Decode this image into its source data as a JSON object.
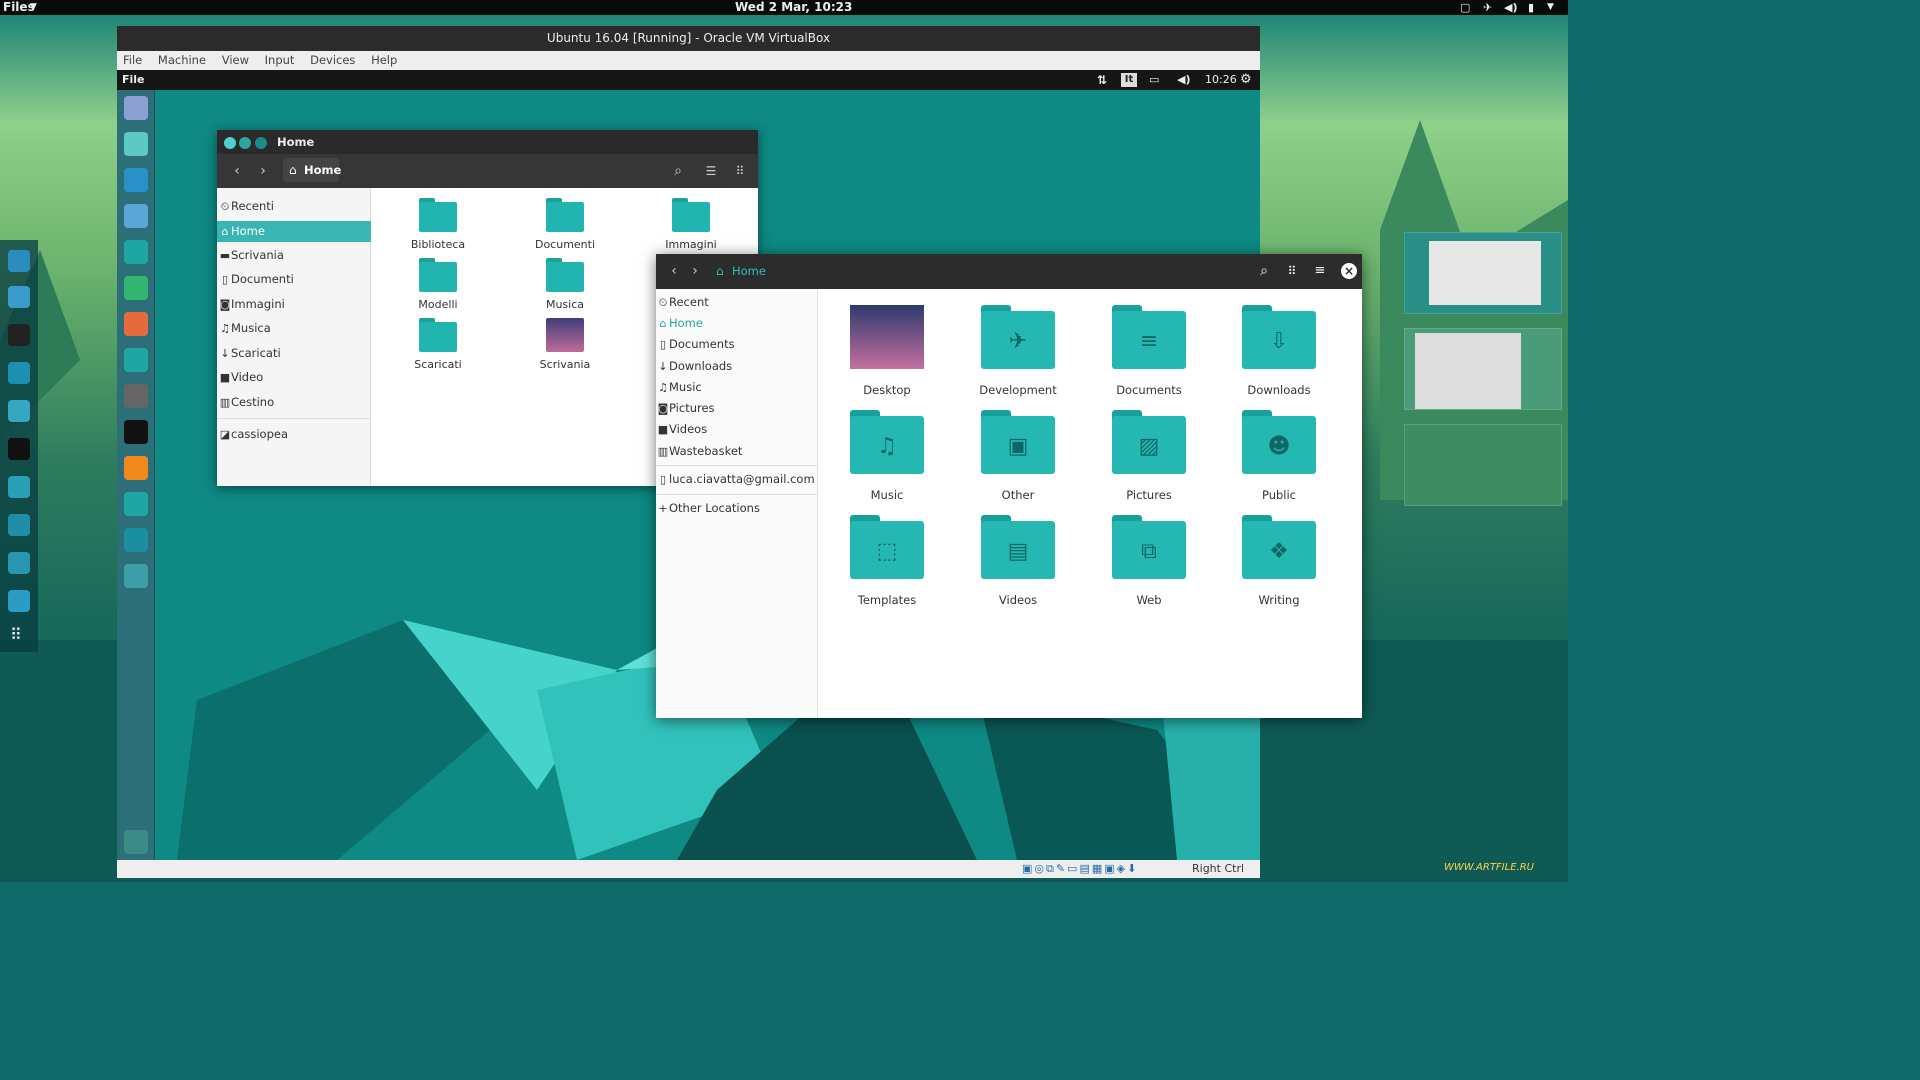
{
  "host": {
    "app_menu": "Files",
    "clock": "Wed  2 Mar, 10:23",
    "tray_icons": [
      "window-icon",
      "airplane-icon",
      "volume-icon",
      "battery-icon",
      "chevron-down-icon"
    ]
  },
  "vbox": {
    "title": "Ubuntu 16.04 [Running] - Oracle VM VirtualBox",
    "menu": [
      "File",
      "Machine",
      "View",
      "Input",
      "Devices",
      "Help"
    ],
    "status_right": "Right Ctrl"
  },
  "guest": {
    "app_menu": "File",
    "keyboard": "It",
    "clock": "10:26"
  },
  "fm1": {
    "title": "Home",
    "breadcrumb": "Home",
    "sidebar": [
      {
        "label": "Recenti",
        "icon": "clock-icon",
        "glyph": "⏲"
      },
      {
        "label": "Home",
        "icon": "home-icon",
        "glyph": "⌂",
        "selected": true
      },
      {
        "label": "Scrivania",
        "icon": "desktop-icon",
        "glyph": "▬"
      },
      {
        "label": "Documenti",
        "icon": "document-icon",
        "glyph": "▯"
      },
      {
        "label": "Immagini",
        "icon": "camera-icon",
        "glyph": "◙"
      },
      {
        "label": "Musica",
        "icon": "music-icon",
        "glyph": "♫"
      },
      {
        "label": "Scaricati",
        "icon": "download-icon",
        "glyph": "↓"
      },
      {
        "label": "Video",
        "icon": "video-icon",
        "glyph": "■"
      },
      {
        "label": "Cestino",
        "icon": "trash-icon",
        "glyph": "▥"
      },
      {
        "label": "cassiopea",
        "icon": "network-drive-icon",
        "glyph": "◪"
      }
    ],
    "folders": [
      {
        "label": "Biblioteca"
      },
      {
        "label": "Documenti"
      },
      {
        "label": "Immagini"
      },
      {
        "label": "Modelli"
      },
      {
        "label": "Musica"
      },
      {
        "label": "Scaricati"
      },
      {
        "label": "Scrivania"
      }
    ]
  },
  "fm2": {
    "breadcrumb": "Home",
    "sidebar": [
      {
        "label": "Recent",
        "icon": "clock-icon",
        "glyph": "⏲"
      },
      {
        "label": "Home",
        "icon": "home-icon",
        "glyph": "⌂",
        "selected": true
      },
      {
        "label": "Documents",
        "icon": "document-icon",
        "glyph": "▯"
      },
      {
        "label": "Downloads",
        "icon": "download-icon",
        "glyph": "↓"
      },
      {
        "label": "Music",
        "icon": "music-icon",
        "glyph": "♫"
      },
      {
        "label": "Pictures",
        "icon": "camera-icon",
        "glyph": "◙"
      },
      {
        "label": "Videos",
        "icon": "video-icon",
        "glyph": "■"
      },
      {
        "label": "Wastebasket",
        "icon": "trash-icon",
        "glyph": "▥"
      },
      {
        "label": "luca.ciavatta@gmail.com",
        "icon": "account-icon",
        "glyph": "▯"
      },
      {
        "label": "Other Locations",
        "icon": "plus-icon",
        "glyph": "+"
      }
    ],
    "folders": [
      {
        "label": "Desktop",
        "glyph": ""
      },
      {
        "label": "Development",
        "glyph": "✈"
      },
      {
        "label": "Documents",
        "glyph": "≡"
      },
      {
        "label": "Downloads",
        "glyph": "⇩"
      },
      {
        "label": "Music",
        "glyph": "♫"
      },
      {
        "label": "Other",
        "glyph": "▣"
      },
      {
        "label": "Pictures",
        "glyph": "▨"
      },
      {
        "label": "Public",
        "glyph": "☻"
      },
      {
        "label": "Templates",
        "glyph": "⬚"
      },
      {
        "label": "Videos",
        "glyph": "▤"
      },
      {
        "label": "Web",
        "glyph": "⧉"
      },
      {
        "label": "Writing",
        "glyph": "❖"
      }
    ]
  },
  "watermark": "WWW.ARTFILE.RU"
}
